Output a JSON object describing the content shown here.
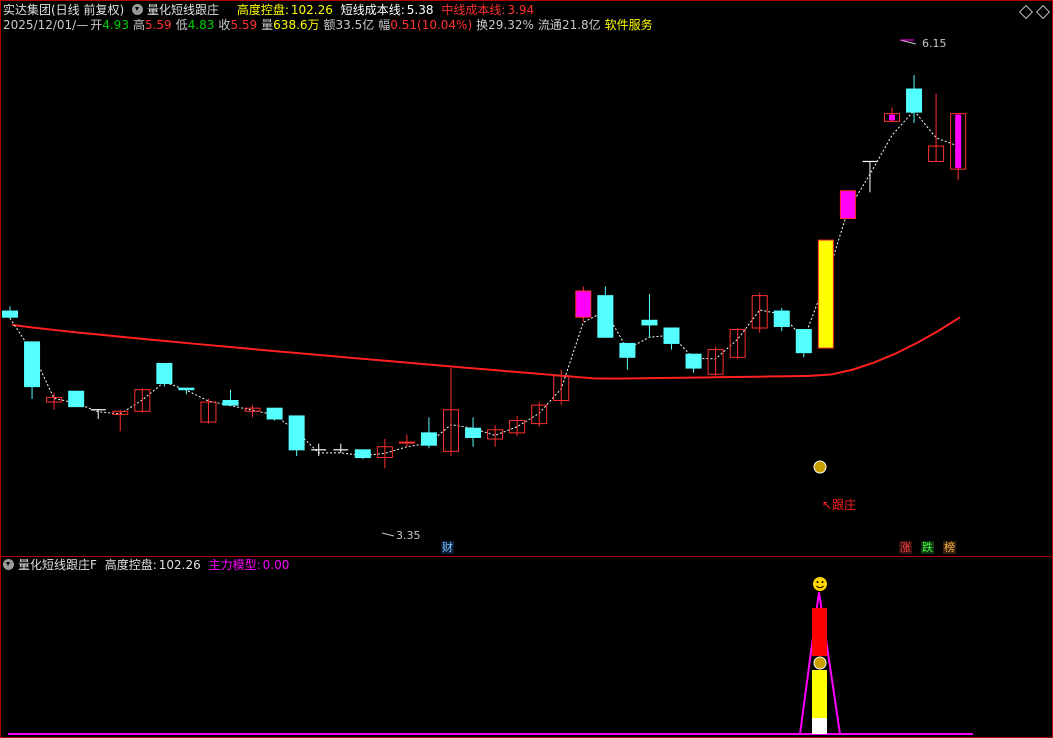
{
  "header": {
    "stock_name": "实达集团(日线 前复权)",
    "indicator_name": "量化短线跟庄",
    "kong_pan_label": "高度控盘:",
    "kong_pan_value": "102.26",
    "short_cost_label": "短线成本线:",
    "short_cost_value": "5.38",
    "mid_cost_label": "中线成本线:",
    "mid_cost_value": "3.94"
  },
  "quote": {
    "date": "2025/12/01/—",
    "open_label": "开",
    "open": "4.93",
    "high_label": "高",
    "high": "5.59",
    "low_label": "低",
    "low": "4.83",
    "close_label": "收",
    "close": "5.59",
    "vol_label": "量",
    "vol": "638.6万",
    "amount_label": "额",
    "amount": "33.5亿",
    "change_label": "幅",
    "change": "0.51(10.04%)",
    "turnover_label": "换",
    "turnover": "29.32%",
    "float_label": "流通",
    "float": "21.8亿",
    "service": "软件服务"
  },
  "chart_annotations": {
    "max_price": "6.15",
    "min_price": "3.35",
    "gen_zhuang": "↖跟庄",
    "cai_badge": "财",
    "zhang_badge": "涨",
    "die_badge": "跌",
    "bang_badge": "榜"
  },
  "sub_header": {
    "indicator_name": "量化短线跟庄F",
    "kong_pan_label": "高度控盘:",
    "kong_pan_value": "102.26",
    "main_model_label": "主力模型:",
    "main_model_value": "0.00"
  },
  "colors": {
    "up": "#ff3030",
    "down": "#54ffff",
    "magenta": "#ff00ff",
    "yellow": "#ffff00",
    "mid_line": "#ff2020",
    "short_line": "#ffffff"
  },
  "chart_data": {
    "type": "candlestick",
    "y_range_price": [
      3.2,
      6.3
    ],
    "candles": [
      {
        "o": 4.62,
        "h": 4.65,
        "l": 4.57,
        "c": 4.58,
        "d": 1,
        "s": "down"
      },
      {
        "o": 4.42,
        "h": 4.42,
        "l": 4.05,
        "c": 4.13,
        "s": "down"
      },
      {
        "o": 4.06,
        "h": 4.09,
        "l": 3.98,
        "c": 4.03,
        "s": "up"
      },
      {
        "o": 4.1,
        "h": 4.1,
        "l": 4.0,
        "c": 4.0,
        "s": "down"
      },
      {
        "o": 3.98,
        "h": 3.98,
        "l": 3.92,
        "c": 3.98,
        "s": "doji"
      },
      {
        "o": 3.95,
        "h": 3.98,
        "l": 3.84,
        "c": 3.97,
        "s": "up"
      },
      {
        "o": 3.97,
        "h": 4.12,
        "l": 3.96,
        "c": 4.11,
        "s": "up"
      },
      {
        "o": 4.28,
        "h": 4.28,
        "l": 4.13,
        "c": 4.15,
        "s": "down"
      },
      {
        "o": 4.12,
        "h": 4.12,
        "l": 4.08,
        "c": 4.11,
        "s": "down"
      },
      {
        "o": 3.9,
        "h": 4.05,
        "l": 3.89,
        "c": 4.03,
        "s": "up"
      },
      {
        "o": 4.04,
        "h": 4.11,
        "l": 4.01,
        "c": 4.01,
        "s": "down"
      },
      {
        "o": 3.97,
        "h": 4.01,
        "l": 3.93,
        "c": 3.99,
        "s": "up"
      },
      {
        "o": 3.99,
        "h": 3.99,
        "l": 3.91,
        "c": 3.92,
        "s": "down"
      },
      {
        "o": 3.94,
        "h": 3.94,
        "l": 3.68,
        "c": 3.72,
        "s": "down"
      },
      {
        "o": 3.72,
        "h": 3.76,
        "l": 3.68,
        "c": 3.72,
        "s": "doji"
      },
      {
        "o": 3.72,
        "h": 3.76,
        "l": 3.7,
        "c": 3.72,
        "s": "doji"
      },
      {
        "o": 3.72,
        "h": 3.72,
        "l": 3.66,
        "c": 3.67,
        "s": "down"
      },
      {
        "o": 3.67,
        "h": 3.79,
        "l": 3.6,
        "c": 3.74,
        "s": "up"
      },
      {
        "o": 3.77,
        "h": 3.82,
        "l": 3.74,
        "c": 3.77,
        "s": "up"
      },
      {
        "o": 3.83,
        "h": 3.93,
        "l": 3.73,
        "c": 3.75,
        "s": "down"
      },
      {
        "o": 3.71,
        "h": 4.25,
        "l": 3.68,
        "c": 3.98,
        "s": "up"
      },
      {
        "o": 3.86,
        "h": 3.93,
        "l": 3.74,
        "c": 3.8,
        "s": "down"
      },
      {
        "o": 3.79,
        "h": 3.88,
        "l": 3.74,
        "c": 3.85,
        "s": "up"
      },
      {
        "o": 3.83,
        "h": 3.94,
        "l": 3.81,
        "c": 3.91,
        "s": "up"
      },
      {
        "o": 3.89,
        "h": 4.03,
        "l": 3.87,
        "c": 4.01,
        "s": "up"
      },
      {
        "o": 4.04,
        "h": 4.24,
        "l": 4.01,
        "c": 4.2,
        "s": "up"
      },
      {
        "o": 4.58,
        "h": 4.78,
        "l": 4.55,
        "c": 4.75,
        "s": "magenta"
      },
      {
        "o": 4.72,
        "h": 4.78,
        "l": 4.45,
        "c": 4.45,
        "s": "down"
      },
      {
        "o": 4.41,
        "h": 4.41,
        "l": 4.24,
        "c": 4.32,
        "s": "down"
      },
      {
        "o": 4.56,
        "h": 4.73,
        "l": 4.45,
        "c": 4.53,
        "s": "down"
      },
      {
        "o": 4.51,
        "h": 4.51,
        "l": 4.37,
        "c": 4.41,
        "s": "down"
      },
      {
        "o": 4.34,
        "h": 4.34,
        "l": 4.22,
        "c": 4.25,
        "s": "down"
      },
      {
        "o": 4.21,
        "h": 4.39,
        "l": 4.2,
        "c": 4.37,
        "s": "up"
      },
      {
        "o": 4.32,
        "h": 4.51,
        "l": 4.31,
        "c": 4.5,
        "s": "up"
      },
      {
        "o": 4.51,
        "h": 4.74,
        "l": 4.48,
        "c": 4.72,
        "s": "up"
      },
      {
        "o": 4.62,
        "h": 4.64,
        "l": 4.49,
        "c": 4.52,
        "s": "down"
      },
      {
        "o": 4.5,
        "h": 4.5,
        "l": 4.32,
        "c": 4.35,
        "s": "down"
      },
      {
        "o": 4.38,
        "h": 5.08,
        "l": 4.38,
        "c": 5.08,
        "s": "yellow"
      },
      {
        "o": 5.22,
        "h": 5.4,
        "l": 5.22,
        "c": 5.4,
        "s": "magenta"
      },
      {
        "o": 5.59,
        "h": 5.59,
        "l": 5.39,
        "c": 5.59,
        "s": "cross"
      },
      {
        "o": 5.9,
        "h": 5.94,
        "l": 5.85,
        "c": 5.85,
        "s": "magenta_hollow"
      },
      {
        "o": 6.06,
        "h": 6.15,
        "l": 5.84,
        "c": 5.91,
        "s": "down"
      },
      {
        "o": 5.59,
        "h": 6.03,
        "l": 5.59,
        "c": 5.69,
        "s": "up"
      },
      {
        "o": 5.9,
        "h": 5.9,
        "l": 5.47,
        "c": 5.54,
        "s": "magenta_hollow"
      }
    ]
  }
}
